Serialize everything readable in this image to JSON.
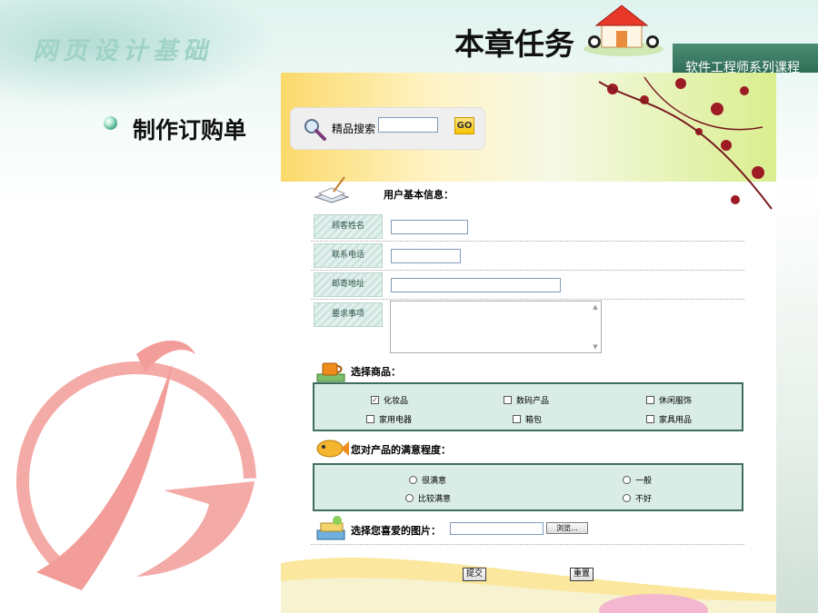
{
  "slide": {
    "header_title": "网页设计基础",
    "chapter_title": "本章任务",
    "course_label": "软件工程师系列课程",
    "bullet_text": "制作订购单"
  },
  "page": {
    "search": {
      "label": "精品搜索",
      "button": "GO"
    },
    "user_section": {
      "title": "用户基本信息：",
      "fields": [
        {
          "label": "顾客姓名",
          "value": ""
        },
        {
          "label": "联系电话",
          "value": ""
        },
        {
          "label": "邮寄地址",
          "value": ""
        },
        {
          "label": "要求事项",
          "value": ""
        }
      ]
    },
    "products_section": {
      "title": "选择商品：",
      "options": [
        {
          "label": "化妆品",
          "checked": true
        },
        {
          "label": "数码产品",
          "checked": false
        },
        {
          "label": "休闲服饰",
          "checked": false
        },
        {
          "label": "家用电器",
          "checked": false
        },
        {
          "label": "箱包",
          "checked": false
        },
        {
          "label": "家具用品",
          "checked": false
        }
      ]
    },
    "satisfaction_section": {
      "title": "您对产品的满意程度：",
      "options": [
        {
          "label": "很满意"
        },
        {
          "label": "一般"
        },
        {
          "label": "比较满意"
        },
        {
          "label": "不好"
        }
      ]
    },
    "picture_section": {
      "title": "选择您喜爱的图片：",
      "browse_button": "浏览..."
    },
    "buttons": {
      "submit": "提交",
      "reset": "重置"
    }
  },
  "colors": {
    "header_green": "#9fd3c3",
    "course_bar": "#3f7c65",
    "option_box": "#d9ece6",
    "option_border": "#3f6d60"
  }
}
